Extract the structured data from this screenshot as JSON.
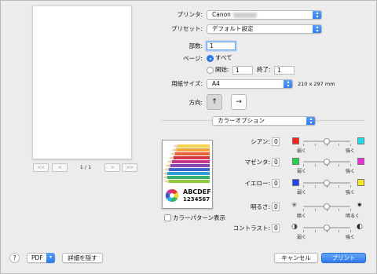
{
  "preview": {
    "page_counter": "1 / 1",
    "first": "<<",
    "prev": "<",
    "next": ">",
    "last": ">>"
  },
  "printer": {
    "label": "プリンタ:",
    "value": "Canon"
  },
  "preset": {
    "label": "プリセット:",
    "value": "デフォルト設定"
  },
  "copies": {
    "label": "部数:",
    "value": "1"
  },
  "pages": {
    "label": "ページ:",
    "all_label": "すべて",
    "from_label": "開始:",
    "from_value": "1",
    "to_label": "終了:",
    "to_value": "1",
    "selected": "all"
  },
  "paper_size": {
    "label": "用紙サイズ:",
    "value": "A4",
    "dimensions": "210 x 297 mm"
  },
  "orientation": {
    "label": "方向:",
    "selected": "portrait"
  },
  "panel_popup": {
    "value": "カラーオプション"
  },
  "color_adjust": [
    {
      "label": "シアン:",
      "value": "0",
      "low": "弱く",
      "high": "強く",
      "low_color": "#ff2020",
      "high_color": "#19dfe9",
      "level": 0.5
    },
    {
      "label": "マゼンタ:",
      "value": "0",
      "low": "弱く",
      "high": "強く",
      "low_color": "#22d64a",
      "high_color": "#f02ad8",
      "level": 0.5
    },
    {
      "label": "イエロー:",
      "value": "0",
      "low": "弱く",
      "high": "強く",
      "low_color": "#2244ee",
      "high_color": "#f7e71a",
      "level": 0.5
    },
    {
      "label": "明るさ:",
      "value": "0",
      "low": "暗く",
      "high": "明るく",
      "low_icon": "sun-dim-icon",
      "high_icon": "sun-bright-icon",
      "level": 0.5
    },
    {
      "label": "コントラスト:",
      "value": "0",
      "low": "弱く",
      "high": "強く",
      "low_icon": "contrast-low-icon",
      "high_icon": "contrast-high-icon",
      "level": 0.5
    }
  ],
  "sample": {
    "line1": "ABCDEF",
    "line2": "1234567"
  },
  "color_pattern": {
    "label": "カラーパターン表示",
    "checked": false
  },
  "footer": {
    "help": "?",
    "pdf_label": "PDF",
    "hide_details": "詳細を隠す",
    "cancel": "キャンセル",
    "print": "プリント"
  },
  "colors": {
    "accent": "#2f7cf0"
  }
}
